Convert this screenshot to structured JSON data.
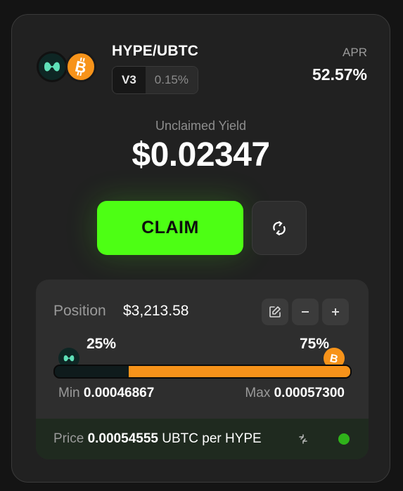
{
  "pair": {
    "name": "HYPE/UBTC",
    "version": "V3",
    "fee": "0.15%",
    "tokens": [
      {
        "symbol": "HYPE",
        "icon": "hype-icon",
        "color": "#0e2624"
      },
      {
        "symbol": "UBTC",
        "icon": "bitcoin-icon",
        "color": "#f7931a"
      }
    ]
  },
  "apr": {
    "label": "APR",
    "value": "52.57%"
  },
  "yield": {
    "label": "Unclaimed Yield",
    "value": "$0.02347"
  },
  "actions": {
    "claim_label": "CLAIM",
    "refresh_icon": "refresh-icon"
  },
  "position": {
    "label": "Position",
    "value": "$3,213.58",
    "icons": [
      "edit-icon",
      "minus-icon",
      "plus-icon"
    ],
    "hype_pct_label": "25%",
    "ubtc_pct_label": "75%",
    "hype_fraction": 0.25,
    "min_label": "Min",
    "min_value": "0.00046867",
    "max_label": "Max",
    "max_value": "0.00057300"
  },
  "price": {
    "label": "Price",
    "value": "0.00054555",
    "unit": "UBTC per HYPE",
    "status_color": "#2fb21a"
  },
  "colors": {
    "accent": "#4dff14",
    "btc": "#f7931a",
    "hype": "#5fe0b8"
  }
}
